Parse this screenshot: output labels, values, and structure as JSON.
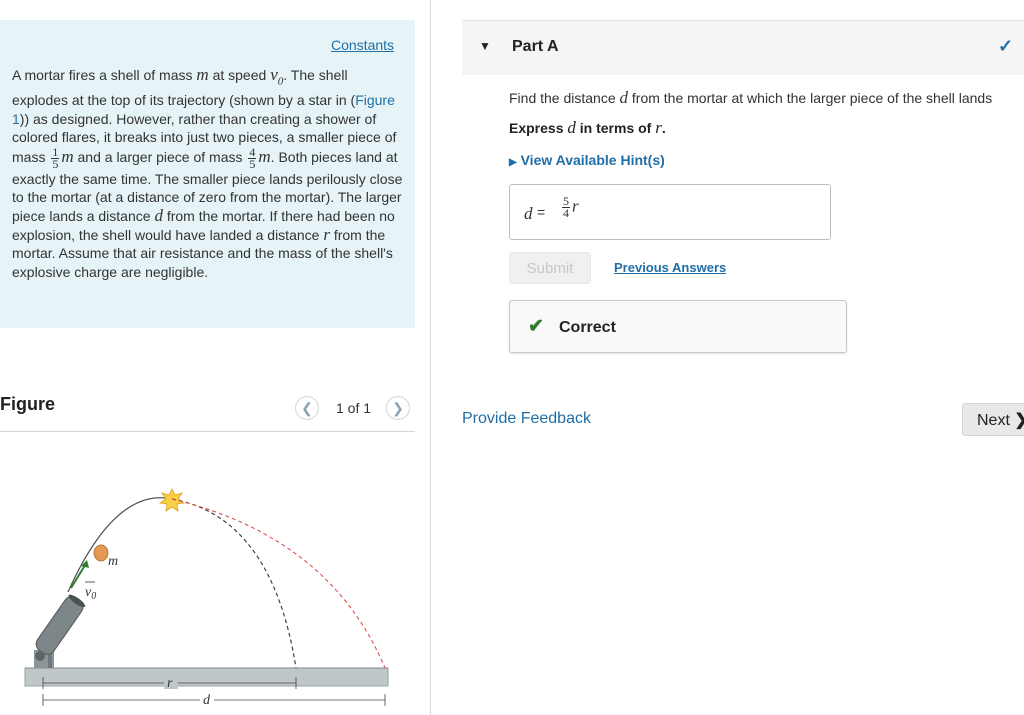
{
  "problem": {
    "constants_label": "Constants",
    "p1": "A mortar fires a shell of mass",
    "m": "m",
    "p2": "at speed",
    "v0": "v",
    "v0sub": "0",
    "p3": ". The shell explodes at the top of its trajectory (shown by a star in",
    "figure_ref_open": "(",
    "figure_ref": "Figure 1",
    "figure_ref_close": ")) as designed. However, rather than creating a shower of colored flares, it breaks into just two pieces, a smaller piece of mass",
    "small_num": "1",
    "small_den": "5",
    "p4": "and a larger piece of mass",
    "large_num": "4",
    "large_den": "5",
    "p5": ". Both pieces land at exactly the same time. The smaller piece lands perilously close to the mortar (at a distance of zero from the mortar). The larger piece lands a distance",
    "d": "d",
    "p6": "from the mortar. If there had been no explosion, the shell would have landed a distance",
    "r": "r",
    "p7": "from the mortar. Assume that air resistance and the mass of the shell's explosive charge are negligible."
  },
  "figure": {
    "title": "Figure",
    "pager": "1 of 1",
    "label_m": "m",
    "label_v0": "v",
    "label_v0_sub": "0",
    "label_r": "r",
    "label_d": "d"
  },
  "part": {
    "title": "Part A",
    "question_pre": "Find the distance",
    "question_var": "d",
    "question_post": "from the mortar at which the larger piece of the shell lands",
    "express_pre": "Express",
    "express_var": "d",
    "express_mid": "in terms of",
    "express_var2": "r",
    "express_end": ".",
    "hints_label": "View Available Hint(s)",
    "answer_lhs": "d",
    "answer_eq": "=",
    "answer_num": "5",
    "answer_den": "4",
    "answer_var": "r",
    "submit_label": "Submit",
    "previous_answers_label": "Previous Answers",
    "correct_label": "Correct"
  },
  "footer": {
    "feedback_label": "Provide Feedback",
    "next_label": "Next"
  },
  "colors": {
    "link": "#1f6ea6",
    "panel_bg": "#e7f4f7",
    "correct_green": "#2e7d32",
    "trajectory_small": "#333333",
    "trajectory_large": "#d9534f"
  },
  "icons": [
    "triangle-down-icon",
    "checkmark-icon",
    "triangle-right-icon",
    "chevron-left-icon",
    "chevron-right-icon",
    "star-burst-icon"
  ]
}
